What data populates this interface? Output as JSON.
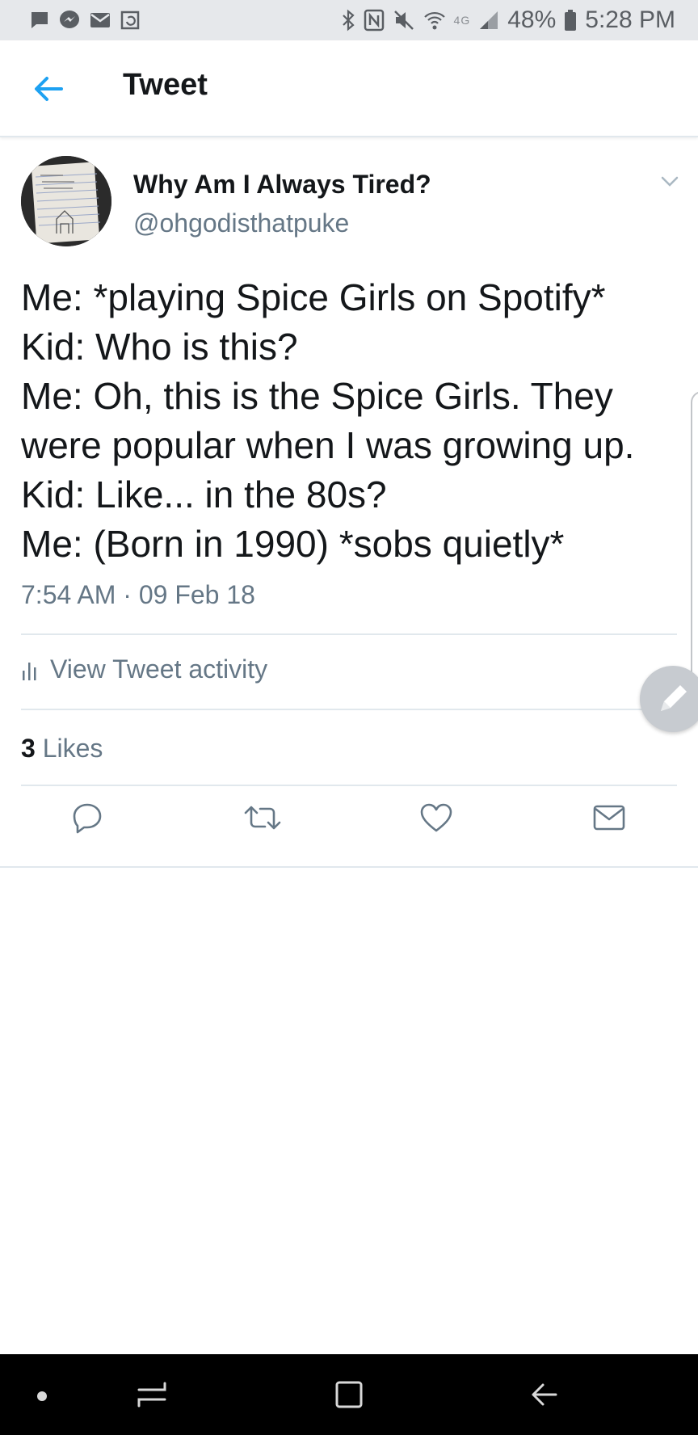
{
  "status_bar": {
    "network_label": "4G",
    "battery": "48%",
    "time": "5:28 PM"
  },
  "header": {
    "title": "Tweet",
    "back_icon": "arrow-left-icon"
  },
  "tweet": {
    "display_name": "Why Am I Always Tired?",
    "handle": "@ohgodisthatpuke",
    "text_lines": [
      "Me: *playing Spice Girls on Spotify*",
      "Kid: Who is this?",
      "Me: Oh, this is the Spice Girls. They",
      "were popular when I was growing up.",
      "Kid: Like... in the 80s?",
      "Me: (Born in 1990) *sobs quietly*"
    ],
    "timestamp": "7:54 AM · 09 Feb 18",
    "activity_label": "View Tweet activity",
    "likes_count": "3",
    "likes_label": "Likes"
  },
  "actions": {
    "reply_icon": "reply-icon",
    "retweet_icon": "retweet-icon",
    "like_icon": "heart-icon",
    "dm_icon": "mail-icon"
  },
  "colors": {
    "accent": "#1da1f2",
    "secondary_text": "#657786",
    "primary_text": "#14171a",
    "divider": "#e1e8ed",
    "status_bar_bg": "#e6e8eb"
  }
}
